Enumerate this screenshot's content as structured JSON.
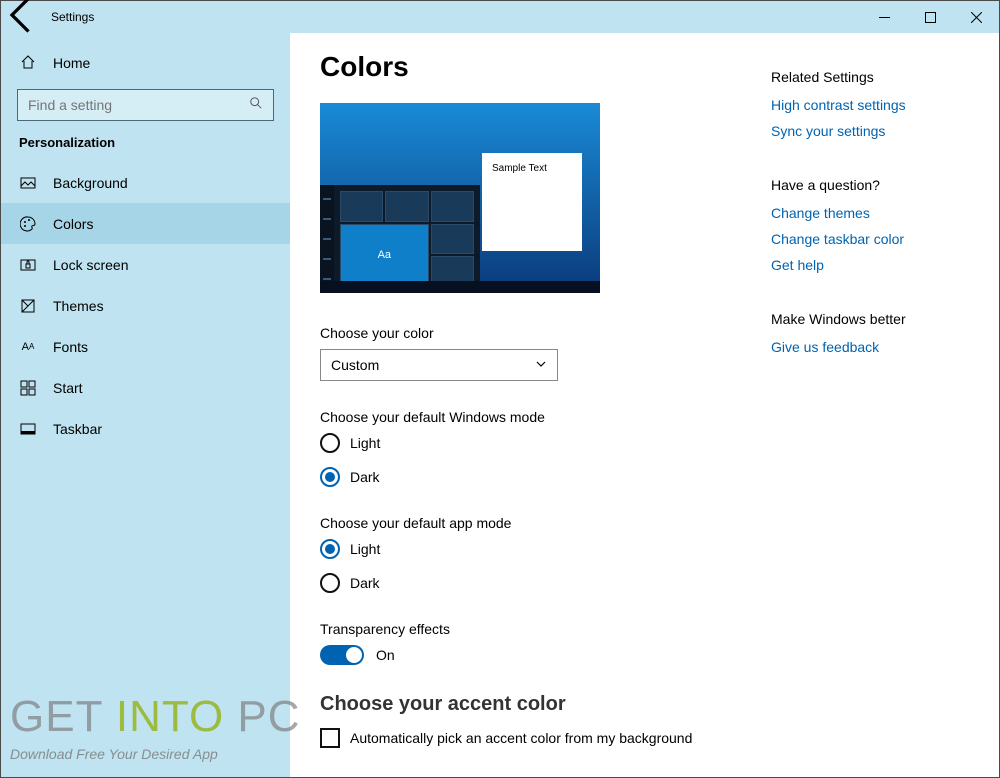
{
  "titlebar": {
    "title": "Settings"
  },
  "sidebar": {
    "home": "Home",
    "search_placeholder": "Find a setting",
    "section": "Personalization",
    "items": [
      {
        "label": "Background",
        "icon": "picture-icon"
      },
      {
        "label": "Colors",
        "icon": "palette-icon"
      },
      {
        "label": "Lock screen",
        "icon": "lock-screen-icon"
      },
      {
        "label": "Themes",
        "icon": "themes-icon"
      },
      {
        "label": "Fonts",
        "icon": "fonts-icon"
      },
      {
        "label": "Start",
        "icon": "start-icon"
      },
      {
        "label": "Taskbar",
        "icon": "taskbar-icon"
      }
    ]
  },
  "main": {
    "heading": "Colors",
    "preview": {
      "sample_text": "Sample Text",
      "tile_text": "Aa"
    },
    "choose_color_label": "Choose your color",
    "color_dropdown": {
      "selected": "Custom"
    },
    "win_mode_label": "Choose your default Windows mode",
    "win_mode": {
      "light": "Light",
      "dark": "Dark",
      "selected": "dark"
    },
    "app_mode_label": "Choose your default app mode",
    "app_mode": {
      "light": "Light",
      "dark": "Dark",
      "selected": "light"
    },
    "transparency_label": "Transparency effects",
    "transparency_state": "On",
    "accent_heading": "Choose your accent color",
    "accent_auto": "Automatically pick an accent color from my background"
  },
  "right": {
    "related_heading": "Related Settings",
    "related_links": [
      "High contrast settings",
      "Sync your settings"
    ],
    "question_heading": "Have a question?",
    "question_links": [
      "Change themes",
      "Change taskbar color",
      "Get help"
    ],
    "better_heading": "Make Windows better",
    "better_links": [
      "Give us feedback"
    ]
  },
  "watermark": {
    "line1_a": "GET ",
    "line1_b": "INTO ",
    "line1_c": "PC",
    "line2": "Download Free Your Desired App"
  }
}
